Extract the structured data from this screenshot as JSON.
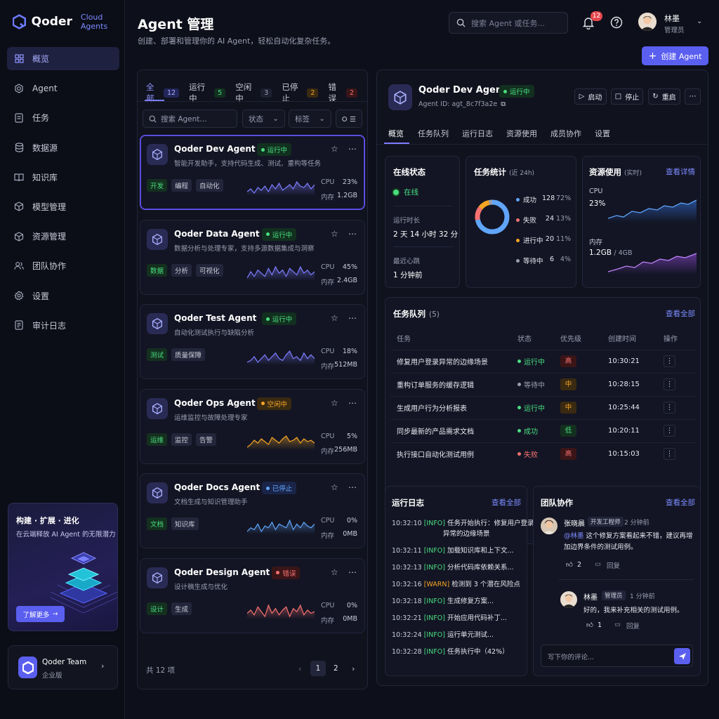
{
  "app": {
    "name": "Qoder",
    "sub": "Cloud Agents"
  },
  "nav": [
    {
      "label": "概览",
      "icon": "grid-icon",
      "active": true
    },
    {
      "label": "Agent",
      "icon": "agent-icon"
    },
    {
      "label": "任务",
      "icon": "task-icon"
    },
    {
      "label": "数据源",
      "icon": "database-icon"
    },
    {
      "label": "知识库",
      "icon": "book-icon"
    },
    {
      "label": "模型管理",
      "icon": "cube-icon"
    },
    {
      "label": "资源管理",
      "icon": "box-icon"
    },
    {
      "label": "团队协作",
      "icon": "team-icon"
    },
    {
      "label": "设置",
      "icon": "gear-icon"
    },
    {
      "label": "审计日志",
      "icon": "log-icon"
    }
  ],
  "promo": {
    "title": "构建 · 扩展 · 进化",
    "text": "在云端释放 AI Agent 的无限潜力",
    "button": "了解更多"
  },
  "team": {
    "name": "Qoder Team",
    "plan": "企业版"
  },
  "header": {
    "title": "Agent 管理",
    "subtitle": "创建、部署和管理你的 AI Agent，轻松自动化复杂任务。",
    "search_placeholder": "搜索 Agent 或任务...",
    "notif_count": "12",
    "user_name": "林墨",
    "user_role": "管理员",
    "create_label": "创建 Agent"
  },
  "list": {
    "tabs": [
      {
        "label": "全部",
        "count": "12",
        "style": "blue",
        "active": true
      },
      {
        "label": "运行中",
        "count": "5",
        "style": "green"
      },
      {
        "label": "空闲中",
        "count": "3",
        "style": "plain"
      },
      {
        "label": "已停止",
        "count": "2",
        "style": "orange"
      },
      {
        "label": "错误",
        "count": "2",
        "style": "red"
      }
    ],
    "search_placeholder": "搜索 Agent...",
    "filter_status": "状态",
    "filter_tag": "标签",
    "total": "共 12 项",
    "pages": [
      "1",
      "2"
    ],
    "cpu_label": "CPU",
    "mem_label": "内存"
  },
  "agents": [
    {
      "name": "Qoder Dev Agent",
      "status": "运行中",
      "st": "run",
      "desc": "智能开发助手，支持代码生成、测试、重构等任务",
      "tags": [
        "开发",
        "编程",
        "自动化"
      ],
      "cpu": "23%",
      "mem": "1.2GB",
      "color": "#7c7cff",
      "spark": [
        10,
        12,
        9,
        13,
        11,
        14,
        10,
        15,
        12,
        16,
        11,
        13,
        15,
        12,
        17,
        14,
        13,
        16,
        12,
        15
      ]
    },
    {
      "name": "Qoder Data Agent",
      "status": "运行中",
      "st": "run",
      "desc": "数据分析与处理专家，支持多源数据集成与洞察",
      "tags": [
        "数据",
        "分析",
        "可视化"
      ],
      "cpu": "45%",
      "mem": "2.4GB",
      "color": "#7c7cff",
      "spark": [
        9,
        13,
        10,
        14,
        12,
        10,
        15,
        11,
        16,
        12,
        14,
        10,
        15,
        13,
        11,
        16,
        12,
        14,
        11,
        13
      ]
    },
    {
      "name": "Qoder Test Agent",
      "status": "运行中",
      "st": "run",
      "desc": "自动化测试执行与缺陷分析",
      "tags": [
        "测试",
        "质量保障"
      ],
      "cpu": "18%",
      "mem": "512MB",
      "color": "#7c7cff",
      "spark": [
        10,
        11,
        13,
        10,
        12,
        14,
        11,
        13,
        15,
        12,
        11,
        14,
        16,
        12,
        13,
        11,
        15,
        12,
        14,
        12
      ]
    },
    {
      "name": "Qoder Ops Agent",
      "status": "空闲中",
      "st": "idle",
      "desc": "运维监控与故障处理专家",
      "tags": [
        "运维",
        "监控",
        "告警"
      ],
      "cpu": "5%",
      "mem": "256MB",
      "color": "#f5a524",
      "spark": [
        8,
        10,
        13,
        11,
        14,
        12,
        10,
        15,
        13,
        11,
        14,
        16,
        12,
        13,
        15,
        11,
        14,
        12,
        13,
        11
      ]
    },
    {
      "name": "Qoder Docs Agent",
      "status": "已停止",
      "st": "stop",
      "desc": "文档生成与知识管理助手",
      "tags": [
        "文档",
        "知识库"
      ],
      "cpu": "0%",
      "mem": "0MB",
      "color": "#60a5fa",
      "spark": [
        10,
        12,
        11,
        14,
        10,
        13,
        12,
        15,
        11,
        14,
        13,
        12,
        16,
        11,
        14,
        12,
        15,
        13,
        12,
        14
      ]
    },
    {
      "name": "Qoder Design Agent",
      "status": "错误",
      "st": "err",
      "desc": "设计稿生成与优化",
      "tags": [
        "设计",
        "生成"
      ],
      "cpu": "0%",
      "mem": "0MB",
      "color": "#f87171",
      "spark": [
        11,
        13,
        10,
        15,
        12,
        9,
        16,
        11,
        14,
        10,
        13,
        15,
        9,
        14,
        12,
        16,
        10,
        13,
        11,
        12
      ]
    }
  ],
  "detail": {
    "name": "Qoder Dev Agent",
    "status": "运行中",
    "agent_id": "Agent ID: agt_8c7f3a2e",
    "buttons": [
      "启动",
      "停止",
      "重启"
    ],
    "tabs": [
      "概览",
      "任务队列",
      "运行日志",
      "资源使用",
      "成员协作",
      "设置"
    ],
    "online": {
      "title": "在线状态",
      "value": "在线",
      "uptime_label": "运行时长",
      "uptime": "2 天 14 小时 32 分",
      "heartbeat_label": "最近心跳",
      "heartbeat": "1 分钟前"
    },
    "task_stats": {
      "title": "任务统计",
      "period": "(近 24h)",
      "items": [
        {
          "label": "成功",
          "count": "128",
          "pct": "72%",
          "color": "#60a5fa",
          "value": 128
        },
        {
          "label": "失败",
          "count": "24",
          "pct": "13%",
          "color": "#f87171",
          "value": 24
        },
        {
          "label": "进行中",
          "count": "20",
          "pct": "11%",
          "color": "#f5a524",
          "value": 20
        },
        {
          "label": "等待中",
          "count": "6",
          "pct": "4%",
          "color": "#9a9eb0",
          "value": 6
        }
      ]
    },
    "resources": {
      "title": "资源使用",
      "period": "(实时)",
      "link": "查看详情",
      "cpu_label": "CPU",
      "cpu": "23%",
      "mem_label": "内存",
      "mem": "1.2GB",
      "mem_total": "/ 4GB"
    },
    "queue": {
      "title": "任务队列",
      "count": "(5)",
      "link": "查看全部",
      "headers": [
        "任务",
        "状态",
        "优先级",
        "创建时间",
        "操作"
      ],
      "rows": [
        {
          "task": "修复用户登录异常的边缘场景",
          "status": "运行中",
          "sc": "#4ade80",
          "pri": "高",
          "pc": "h",
          "time": "10:30:21"
        },
        {
          "task": "重构订单服务的缓存逻辑",
          "status": "等待中",
          "sc": "#9a9eb0",
          "pri": "中",
          "pc": "m",
          "time": "10:28:15"
        },
        {
          "task": "生成用户行为分析报表",
          "status": "运行中",
          "sc": "#4ade80",
          "pri": "中",
          "pc": "m",
          "time": "10:25:44"
        },
        {
          "task": "同步最新的产品需求文档",
          "status": "成功",
          "sc": "#4ade80",
          "pri": "低",
          "pc": "l",
          "time": "10:20:11"
        },
        {
          "task": "执行接口自动化测试用例",
          "status": "失败",
          "sc": "#f87171",
          "pri": "高",
          "pc": "h",
          "time": "10:15:03"
        }
      ]
    },
    "logs": {
      "title": "运行日志",
      "link": "查看全部",
      "lines": [
        {
          "t": "10:32:10",
          "lv": "[INFO]",
          "msg": "任务开始执行：修复用户登录",
          "msg2": "异常的边缘场景"
        },
        {
          "t": "10:32:11",
          "lv": "[INFO]",
          "msg": "加载知识库和上下文..."
        },
        {
          "t": "10:32:13",
          "lv": "[INFO]",
          "msg": "分析代码库依赖关系..."
        },
        {
          "t": "10:32:16",
          "lv": "[WARN]",
          "msg": "检测到 3 个潜在风险点"
        },
        {
          "t": "10:32:18",
          "lv": "[INFO]",
          "msg": "生成修复方案..."
        },
        {
          "t": "10:32:21",
          "lv": "[INFO]",
          "msg": "开始应用代码补丁..."
        },
        {
          "t": "10:32:24",
          "lv": "[INFO]",
          "msg": "运行单元测试..."
        },
        {
          "t": "10:32:28",
          "lv": "[INFO]",
          "msg": "任务执行中（42%）"
        }
      ]
    },
    "collab": {
      "title": "团队协作",
      "link": "查看全部",
      "c1": {
        "name": "张晓晨",
        "role": "开发工程师",
        "time": "2 分钟前",
        "mention": "@林墨",
        "text1": " 这个修复方案看起来不错，建议再增",
        "text2": "加边界条件的测试用例。",
        "likes": "2",
        "reply": "回复"
      },
      "c2": {
        "name": "林墨",
        "role": "管理员",
        "time": "1 分钟前",
        "text": "好的，我来补充相关的测试用例。",
        "likes": "1",
        "reply": "回复"
      },
      "placeholder": "写下你的评论..."
    }
  }
}
